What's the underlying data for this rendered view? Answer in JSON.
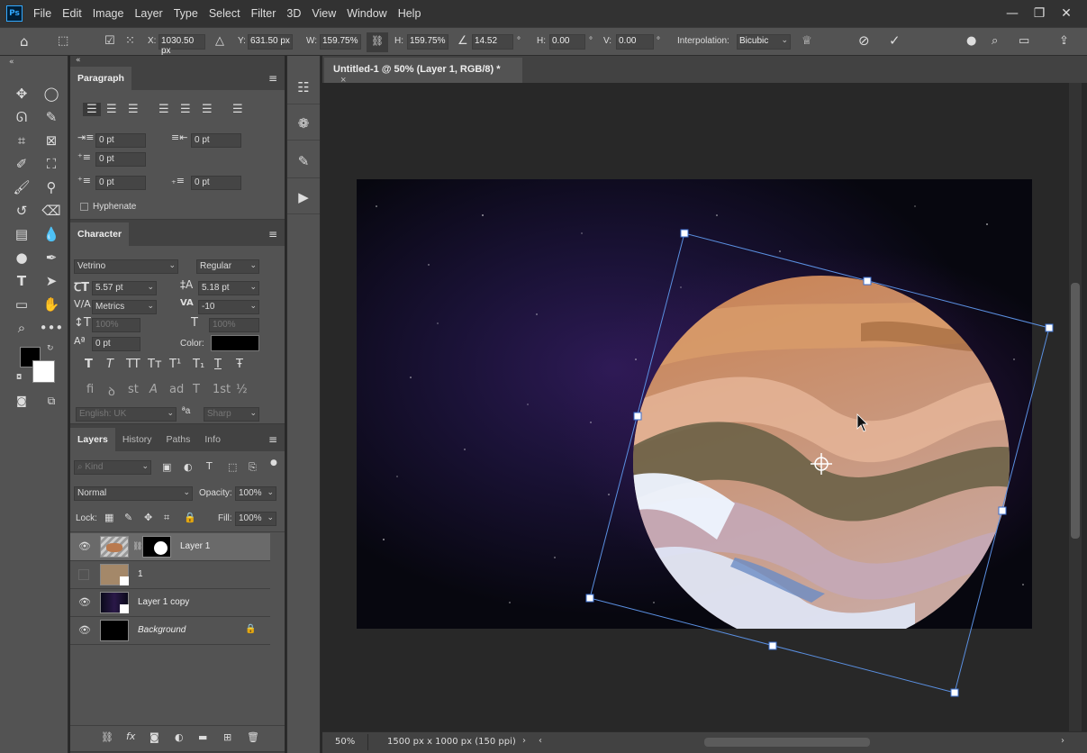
{
  "app": {
    "logo": "Ps"
  },
  "menu": [
    "File",
    "Edit",
    "Image",
    "Layer",
    "Type",
    "Select",
    "Filter",
    "3D",
    "View",
    "Window",
    "Help"
  ],
  "window_controls": {
    "minimize": "—",
    "restore": "❐",
    "close": "✕"
  },
  "options": {
    "x_label": "X:",
    "x_value": "1030.50 px",
    "y_label": "Y:",
    "y_value": "631.50 px",
    "w_label": "W:",
    "w_value": "159.75%",
    "h_label": "H:",
    "h_value": "159.75%",
    "angle_value": "14.52",
    "angle_unit": "°",
    "hskew_label": "H:",
    "hskew_value": "0.00",
    "hskew_unit": "°",
    "vskew_label": "V:",
    "vskew_value": "0.00",
    "vskew_unit": "°",
    "interp_label": "Interpolation:",
    "interp_value": "Bicubic"
  },
  "paragraph": {
    "tab": "Paragraph",
    "indent_left": "0 pt",
    "indent_right": "0 pt",
    "first_line": "0 pt",
    "space_before": "0 pt",
    "space_after": "0 pt",
    "hyphenate": "Hyphenate"
  },
  "character": {
    "tab": "Character",
    "font_family": "Vetrino",
    "font_style": "Regular",
    "size": "5.57 pt",
    "leading": "5.18 pt",
    "kerning": "Metrics",
    "tracking": "-10",
    "vscale": "100%",
    "hscale": "100%",
    "baseline": "0 pt",
    "color_label": "Color:",
    "language": "English: UK",
    "aa_glyph": "ªa",
    "antialias": "Sharp",
    "type_styles": [
      "T",
      "T",
      "TT",
      "Tт",
      "T¹",
      "T₁",
      "T",
      "Ŧ"
    ],
    "opentype": [
      "fi",
      "ꝺ",
      "st",
      "A",
      "ad",
      "T",
      "1st",
      "½"
    ]
  },
  "layers_panel": {
    "tabs": [
      "Layers",
      "History",
      "Paths",
      "Info"
    ],
    "kind": "Kind",
    "blend_mode": "Normal",
    "opacity_label": "Opacity:",
    "opacity": "100%",
    "lock_label": "Lock:",
    "fill_label": "Fill:",
    "fill": "100%",
    "layers": [
      {
        "name": "Layer 1",
        "visible": true,
        "selected": true
      },
      {
        "name": "1",
        "visible": false,
        "selected": false
      },
      {
        "name": "Layer 1 copy",
        "visible": true,
        "selected": false
      },
      {
        "name": "Background",
        "visible": true,
        "selected": false,
        "locked": true
      }
    ]
  },
  "document": {
    "tab_title": "Untitled-1 @ 50% (Layer 1, RGB/8) *",
    "close": "×"
  },
  "status": {
    "zoom": "50%",
    "dimensions": "1500 px x 1000 px (150 ppi)"
  },
  "colors": {
    "accent": "#31a8ff",
    "panel": "#535353",
    "bg": "#282828",
    "transform_line": "#5a8fe0"
  }
}
